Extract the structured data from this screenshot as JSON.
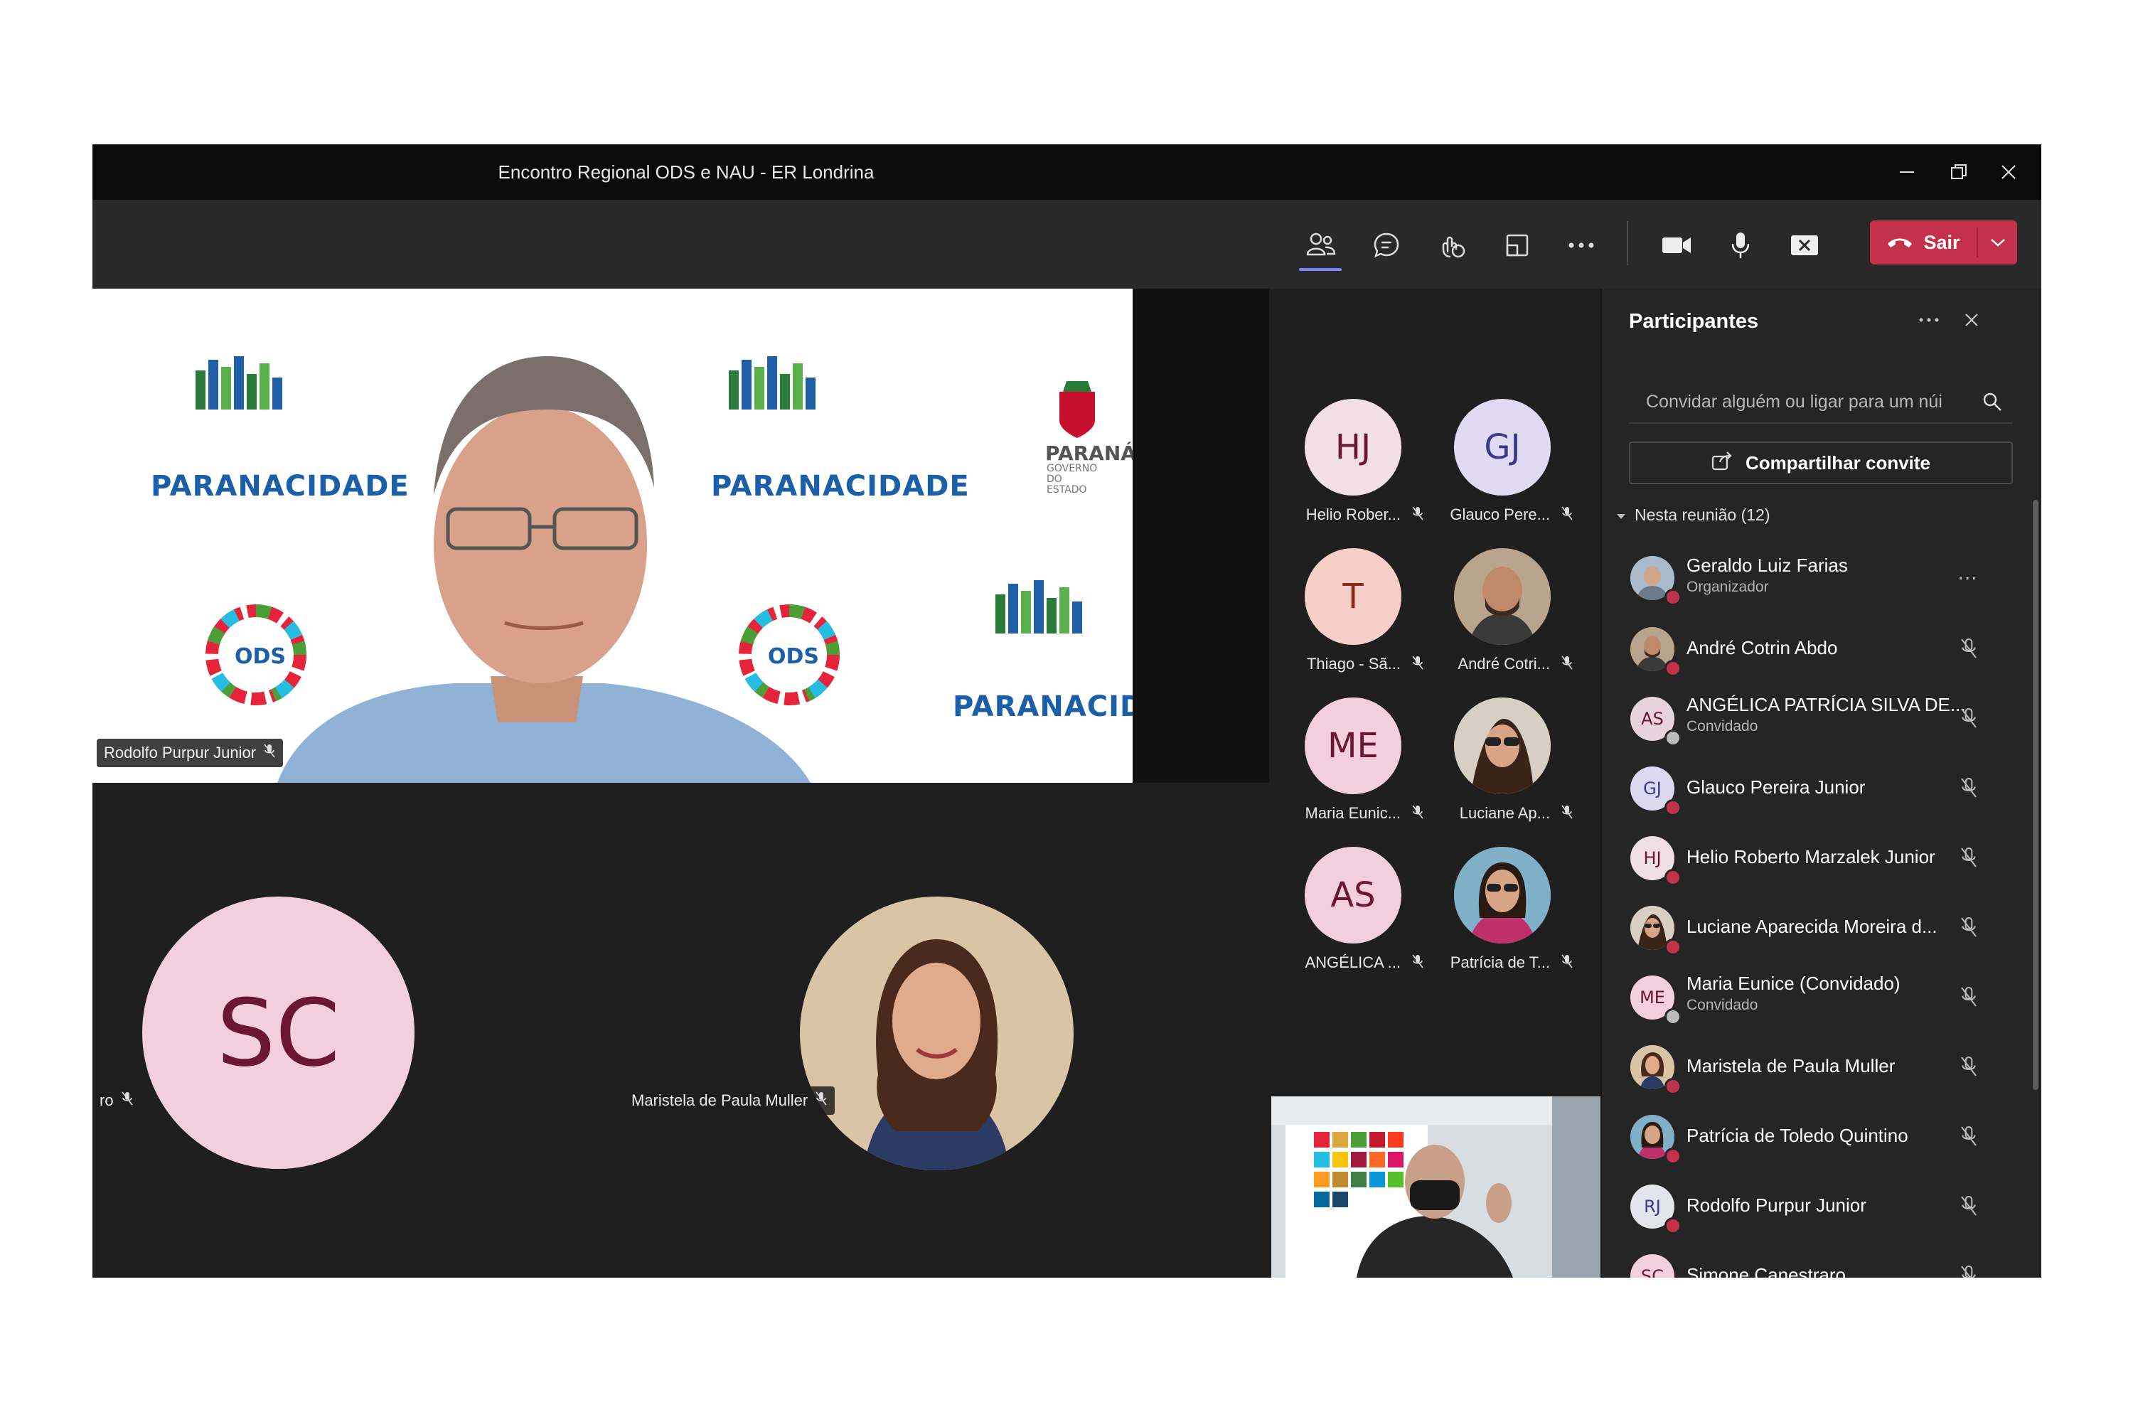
{
  "window": {
    "title": "Encontro Regional ODS e NAU - ER Londrina",
    "controls": [
      "minimize-icon",
      "restore-icon",
      "close-icon"
    ]
  },
  "toolbar": {
    "icons": [
      "participants-icon",
      "chat-icon",
      "reactions-icon",
      "layout-icon",
      "more-icon",
      "camera-icon",
      "microphone-icon",
      "share-screen-icon"
    ],
    "leave_label": "Sair",
    "leave_color": "#c4314b",
    "active_color": "#7f85f5"
  },
  "stage": {
    "main_video": {
      "name": "Rodolfo Purpur Junior",
      "logos": [
        "PARANACIDADE",
        "ODS",
        "PARANÁ",
        "GOVERNO DO ESTADO"
      ]
    },
    "tile_left": {
      "initials": "SC",
      "name_fragment": "ro"
    },
    "tile_right": {
      "name": "Maristela de Paula Muller"
    }
  },
  "grid": [
    {
      "initials": "HJ",
      "name": "Helio Rober...",
      "color": "#f3dfe6"
    },
    {
      "initials": "GJ",
      "name": "Glauco Pere...",
      "color": "#e0dbf3"
    },
    {
      "initials": "T",
      "name": "Thiago - Sã...",
      "color": "#f6cfc8"
    },
    {
      "initials": "",
      "name": "André Cotri...",
      "color": "#8a6a52"
    },
    {
      "initials": "ME",
      "name": "Maria Eunic...",
      "color": "#f3cfdd"
    },
    {
      "initials": "",
      "name": "Luciane Ap...",
      "color": "#c9a48c"
    },
    {
      "initials": "AS",
      "name": "ANGÉLICA ...",
      "color": "#f3cfdd"
    },
    {
      "initials": "",
      "name": "Patrícia de T...",
      "color": "#b88ea0"
    }
  ],
  "panel": {
    "title": "Participantes",
    "search_placeholder": "Convidar alguém ou ligar para um núi",
    "share_label": "Compartilhar convite",
    "section_label": "Nesta reunião (12)",
    "participants": [
      {
        "initials": "",
        "name": "Geraldo Luiz Farias",
        "role": "Organizador",
        "photo": true
      },
      {
        "initials": "",
        "name": "André Cotrin Abdo",
        "role": "",
        "photo": true
      },
      {
        "initials": "AS",
        "name": "ANGÉLICA PATRÍCIA SILVA DE...",
        "role": "Convidado",
        "photo": false
      },
      {
        "initials": "GJ",
        "name": "Glauco Pereira Junior",
        "role": "",
        "photo": false
      },
      {
        "initials": "HJ",
        "name": "Helio Roberto Marzalek Junior",
        "role": "",
        "photo": false
      },
      {
        "initials": "",
        "name": "Luciane Aparecida Moreira d...",
        "role": "",
        "photo": true
      },
      {
        "initials": "ME",
        "name": "Maria Eunice (Convidado)",
        "role": "Convidado",
        "photo": false
      },
      {
        "initials": "",
        "name": "Maristela de Paula Muller",
        "role": "",
        "photo": true
      },
      {
        "initials": "",
        "name": "Patrícia de Toledo Quintino",
        "role": "",
        "photo": true
      },
      {
        "initials": "RJ",
        "name": "Rodolfo Purpur Junior",
        "role": "",
        "photo": false
      },
      {
        "initials": "SC",
        "name": "Simone Canestraro",
        "role": "",
        "photo": false
      }
    ]
  }
}
